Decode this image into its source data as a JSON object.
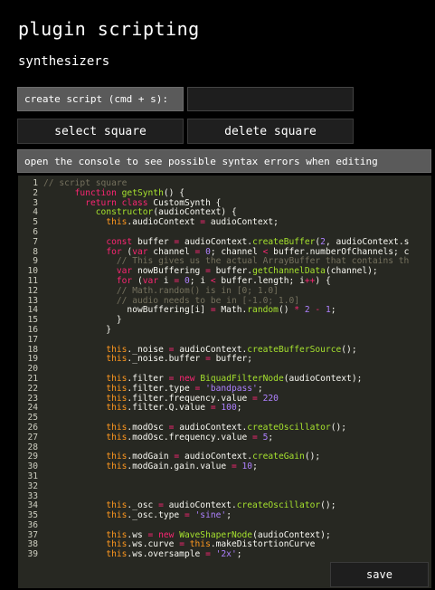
{
  "header": {
    "title": "plugin scripting",
    "subtitle": "synthesizers"
  },
  "create_script": {
    "label": "create script (cmd + s):",
    "input_value": ""
  },
  "buttons": {
    "select_square": "select square",
    "delete_square": "delete square",
    "save": "save"
  },
  "hint_text": "open the console to see possible syntax errors when editing",
  "editor": {
    "lines": [
      "// script square",
      "      function getSynth() {",
      "        return class CustomSynth {",
      "          constructor(audioContext) {",
      "            this.audioContext = audioContext;",
      "",
      "            const buffer = audioContext.createBuffer(2, audioContext.s",
      "            for (var channel = 0; channel < buffer.numberOfChannels; c",
      "              // This gives us the actual ArrayBuffer that contains th",
      "              var nowBuffering = buffer.getChannelData(channel);",
      "              for (var i = 0; i < buffer.length; i++) {",
      "              // Math.random() is in [0; 1.0]",
      "              // audio needs to be in [-1.0; 1.0]",
      "                nowBuffering[i] = Math.random() * 2 - 1;",
      "              }",
      "            }",
      "",
      "            this._noise = audioContext.createBufferSource();",
      "            this._noise.buffer = buffer;",
      "",
      "            this.filter = new BiquadFilterNode(audioContext);",
      "            this.filter.type = 'bandpass';",
      "            this.filter.frequency.value = 220",
      "            this.filter.Q.value = 100;",
      "",
      "            this.modOsc = audioContext.createOscillator();",
      "            this.modOsc.frequency.value = 5;",
      "",
      "            this.modGain = audioContext.createGain();",
      "            this.modGain.gain.value = 10;",
      "",
      "",
      "",
      "            this._osc = audioContext.createOscillator();",
      "            this._osc.type = 'sine';",
      "",
      "            this.ws = new WaveShaperNode(audioContext);",
      "            this.ws.curve = this.makeDistortionCurve",
      "            this.ws.oversample = '2x';"
    ]
  },
  "colors": {
    "background": "#000000",
    "editor_bg": "#272822",
    "panel_gray": "#5a5a5a",
    "keyword": "#f92672",
    "this_kw": "#fd971f",
    "function_name": "#a6e22e",
    "string_number": "#ae81ff",
    "comment": "#75715e",
    "plain": "#f8f8f2"
  }
}
